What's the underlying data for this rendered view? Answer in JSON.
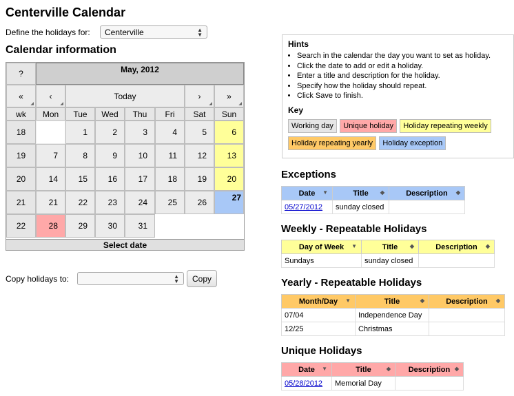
{
  "page": {
    "title": "Centerville Calendar",
    "define_label": "Define the holidays for:",
    "branch_selected": "Centerville",
    "calendar_info_title": "Calendar information"
  },
  "calendar": {
    "help": "?",
    "month_title": "May, 2012",
    "prev_year": "«",
    "prev_month": "‹",
    "today": "Today",
    "next_month": "›",
    "next_year": "»",
    "headers": [
      "wk",
      "Mon",
      "Tue",
      "Wed",
      "Thu",
      "Fri",
      "Sat",
      "Sun"
    ],
    "weeks": [
      {
        "wk": "18",
        "days": [
          "",
          "1",
          "2",
          "3",
          "4",
          "5",
          "6"
        ]
      },
      {
        "wk": "19",
        "days": [
          "7",
          "8",
          "9",
          "10",
          "11",
          "12",
          "13"
        ]
      },
      {
        "wk": "20",
        "days": [
          "14",
          "15",
          "16",
          "17",
          "18",
          "19",
          "20"
        ]
      },
      {
        "wk": "21",
        "days": [
          "21",
          "22",
          "23",
          "24",
          "25",
          "26",
          "27"
        ]
      },
      {
        "wk": "22",
        "days": [
          "28",
          "29",
          "30",
          "31",
          "",
          "",
          ""
        ]
      }
    ],
    "select_date": "Select date"
  },
  "copy": {
    "label": "Copy holidays to:",
    "selected": "",
    "button": "Copy"
  },
  "hints": {
    "title": "Hints",
    "items": [
      "Search in the calendar the day you want to set as holiday.",
      "Click the date to add or edit a holiday.",
      "Enter a title and description for the holiday.",
      "Specify how the holiday should repeat.",
      "Click Save to finish."
    ],
    "key_title": "Key",
    "key_items": [
      "Working day",
      "Unique holiday",
      "Holiday repeating weekly",
      "Holiday repeating yearly",
      "Holiday exception"
    ]
  },
  "exceptions": {
    "title": "Exceptions",
    "headers": [
      "Date",
      "Title",
      "Description"
    ],
    "rows": [
      [
        "05/27/2012",
        "sunday closed",
        ""
      ]
    ]
  },
  "weekly": {
    "title": "Weekly - Repeatable Holidays",
    "headers": [
      "Day of Week",
      "Title",
      "Description"
    ],
    "rows": [
      [
        "Sundays",
        "sunday closed",
        ""
      ]
    ]
  },
  "yearly": {
    "title": "Yearly - Repeatable Holidays",
    "headers": [
      "Month/Day",
      "Title",
      "Description"
    ],
    "rows": [
      [
        "07/04",
        "Independence Day",
        ""
      ],
      [
        "12/25",
        "Christmas",
        ""
      ]
    ]
  },
  "unique": {
    "title": "Unique Holidays",
    "headers": [
      "Date",
      "Title",
      "Description"
    ],
    "rows": [
      [
        "05/28/2012",
        "Memorial Day",
        ""
      ]
    ]
  },
  "colors": {
    "working": "#e6e6e6",
    "unique": "#ffa8a8",
    "weekly": "#ffff99",
    "yearly": "#ffc966",
    "exception": "#a8c8f7",
    "link": "#0000cc"
  }
}
